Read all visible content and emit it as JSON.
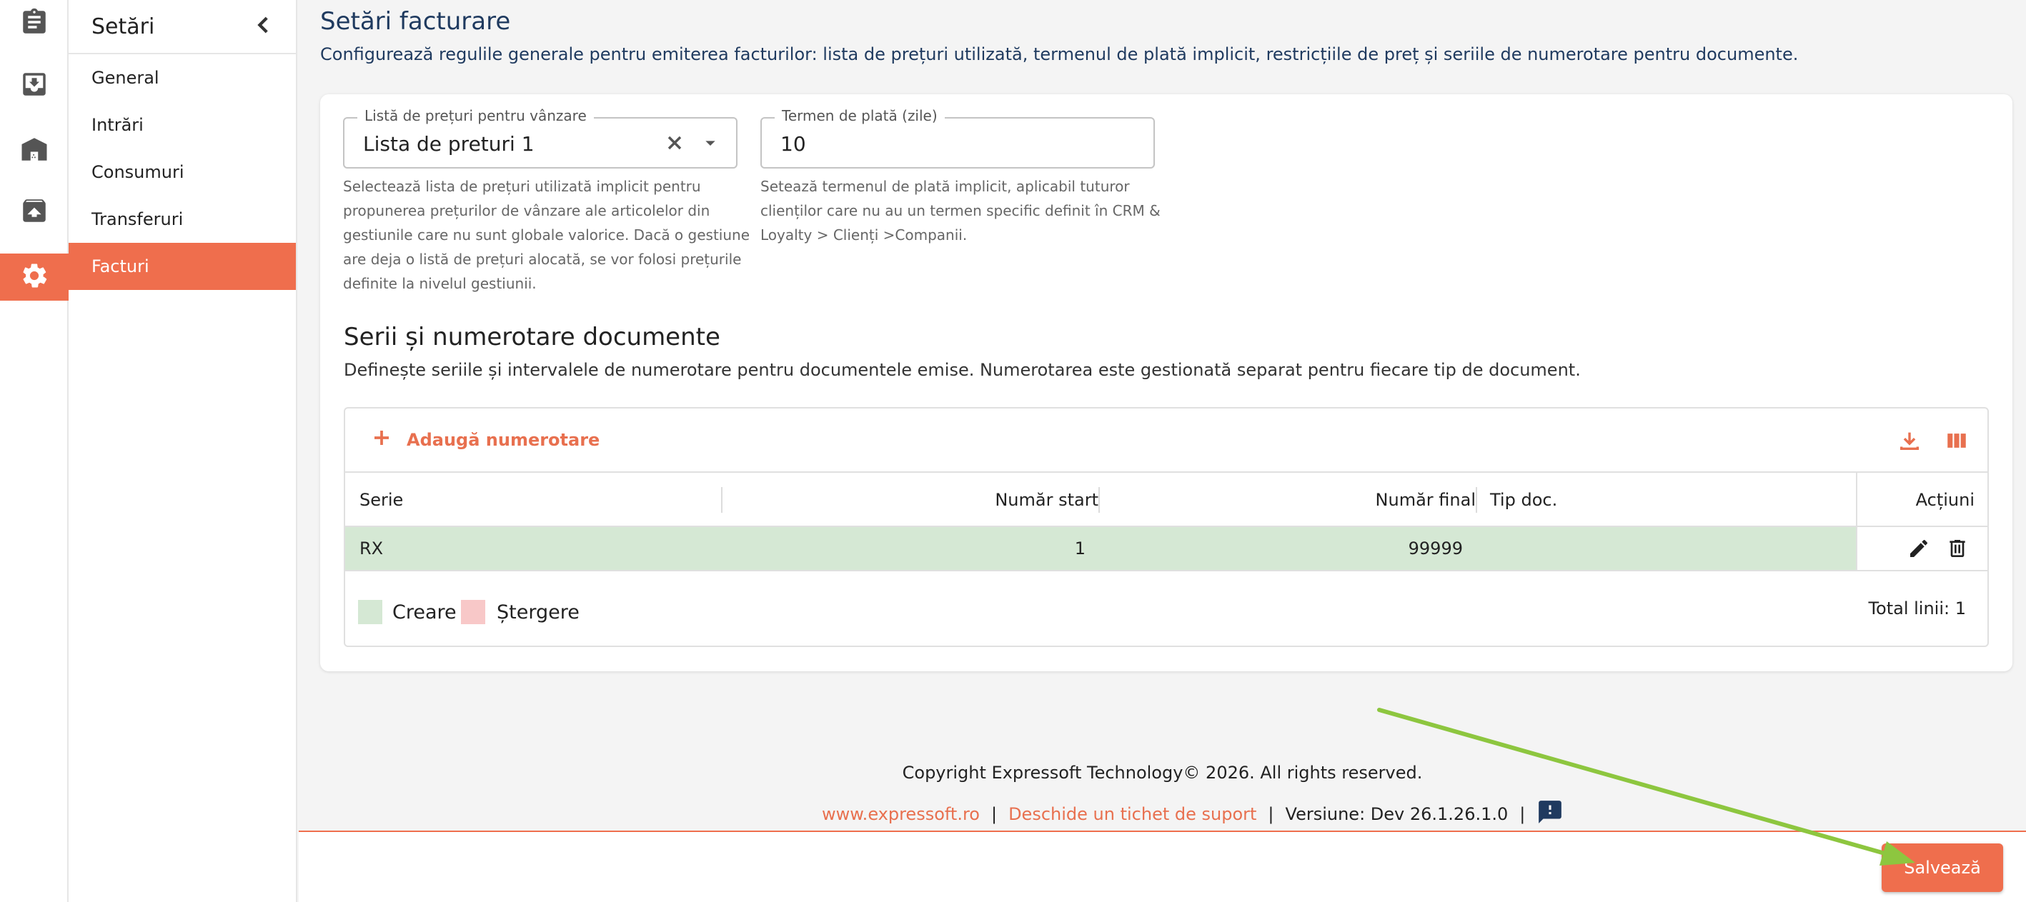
{
  "sidebar": {
    "title": "Setări",
    "items": [
      {
        "label": "General"
      },
      {
        "label": "Intrări"
      },
      {
        "label": "Consumuri"
      },
      {
        "label": "Transferuri"
      },
      {
        "label": "Facturi"
      }
    ]
  },
  "rail_icons": [
    "clipboard-icon",
    "inbox-import-icon",
    "warehouse-icon",
    "archive-upload-icon",
    "gear-icon"
  ],
  "page": {
    "title": "Setări facturare",
    "description": "Configurează regulile generale pentru emiterea facturilor: lista de prețuri utilizată, termenul de plată implicit, restricțiile de preț și seriile de numerotare pentru documente."
  },
  "price_list": {
    "label": "Listă de prețuri pentru vânzare",
    "value": "Lista de preturi 1",
    "helper_lines": [
      "Selectează lista de prețuri utilizată implicit pentru",
      "propunerea prețurilor de vânzare ale articolelor din",
      "gestiunile care nu sunt globale valorice. Dacă o gestiune",
      "are deja o listă de prețuri alocată, se vor folosi prețurile",
      "definite la nivelul gestiunii."
    ]
  },
  "payment_term": {
    "label": "Termen de plată (zile)",
    "value": "10",
    "helper_lines": [
      "Setează termenul de plată implicit, aplicabil tuturor",
      "clienților care nu au un termen specific definit în CRM &",
      "Loyalty > Clienți >Companii."
    ]
  },
  "numbering": {
    "title": "Serii și numerotare documente",
    "description": "Definește seriile și intervalele de numerotare pentru documentele emise. Numerotarea este gestionată separat pentru fiecare tip de document.",
    "add_label": "Adaugă numerotare",
    "columns": {
      "serie": "Serie",
      "start": "Număr start",
      "final": "Număr final",
      "tip": "Tip doc.",
      "actions": "Acțiuni"
    },
    "rows": [
      {
        "serie": "RX",
        "start": "1",
        "final": "99999",
        "tip": ""
      }
    ],
    "legend": {
      "create": "Creare",
      "delete": "Ștergere"
    },
    "total": "Total linii: 1"
  },
  "footer": {
    "copyright": "Copyright Expressoft Technology© 2026. All rights reserved.",
    "site": "www.expressoft.ro",
    "separator": "|",
    "ticket": "Deschide un tichet de suport",
    "version": "Versiune: Dev 26.1.26.1.0",
    "save": "Salvează"
  },
  "colors": {
    "accent": "#ef6e4d",
    "title_blue": "#1f3a5f",
    "create_row": "#d5e8d4",
    "delete_swatch": "#f8c8c8",
    "arrow": "#8dc63f"
  }
}
